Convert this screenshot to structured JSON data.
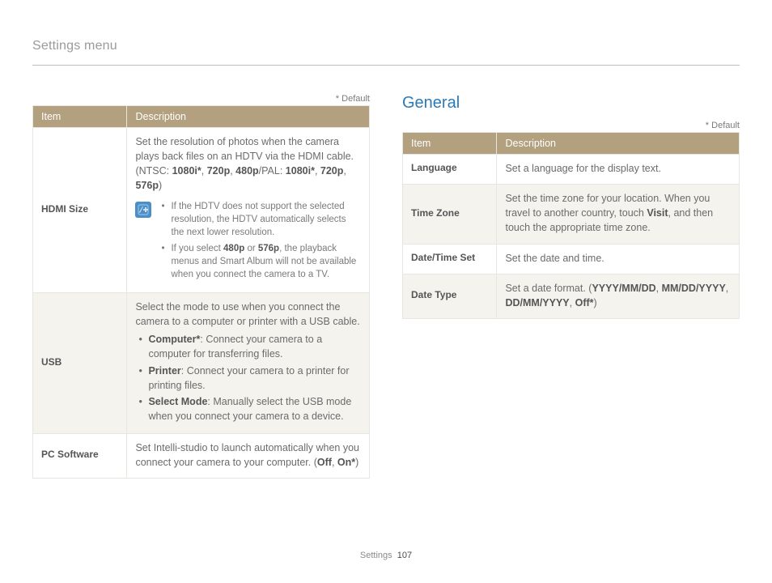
{
  "page": {
    "header": "Settings menu",
    "footer_section": "Settings",
    "footer_page": "107"
  },
  "default_label": "* Default",
  "col_headers": {
    "item": "Item",
    "desc": "Description"
  },
  "left": {
    "rows": [
      {
        "item": "HDMI Size",
        "desc_intro": "Set the resolution of photos when the camera plays back files on an HDTV via the HDMI cable. (NTSC: ",
        "modes_ntsc": [
          "1080i*",
          "720p",
          "480p"
        ],
        "pal_label": "/PAL: ",
        "modes_pal": [
          "1080i*",
          "720p",
          "576p"
        ],
        "close": ")",
        "notes": [
          "If the HDTV does not support the selected resolution, the HDTV automatically selects the next lower resolution.",
          "If you select 480p or 576p, the playback menus and Smart Album will not be available when you connect the camera to a TV."
        ],
        "notes_bold": {
          "1": [
            "480p",
            "576p"
          ]
        }
      },
      {
        "item": "USB",
        "desc_intro": "Select the mode to use when you connect the camera to a computer or printer with a USB cable.",
        "options": [
          {
            "name": "Computer*",
            "text": ": Connect your camera to a computer for transferring files."
          },
          {
            "name": "Printer",
            "text": ": Connect your camera to a printer for printing files."
          },
          {
            "name": "Select Mode",
            "text": ": Manually select the USB mode when you connect your camera to a device."
          }
        ]
      },
      {
        "item": "PC Software",
        "desc_intro": "Set Intelli-studio to launch automatically when you connect your camera to your computer. (",
        "opts": [
          "Off",
          "On*"
        ],
        "close": ")"
      }
    ]
  },
  "right": {
    "section_title": "General",
    "rows": [
      {
        "item": "Language",
        "desc": "Set a language for the display text."
      },
      {
        "item": "Time Zone",
        "desc_pre": "Set the time zone for your location. When you travel to another country, touch ",
        "bold": "Visit",
        "desc_post": ", and then touch the appropriate time zone."
      },
      {
        "item": "Date/Time Set",
        "desc": "Set the date and time."
      },
      {
        "item": "Date Type",
        "desc_pre": "Set a date format. (",
        "opts": [
          "YYYY/MM/DD",
          "MM/DD/YYYY",
          "DD/MM/YYYY",
          "Off*"
        ],
        "close": ")"
      }
    ]
  }
}
